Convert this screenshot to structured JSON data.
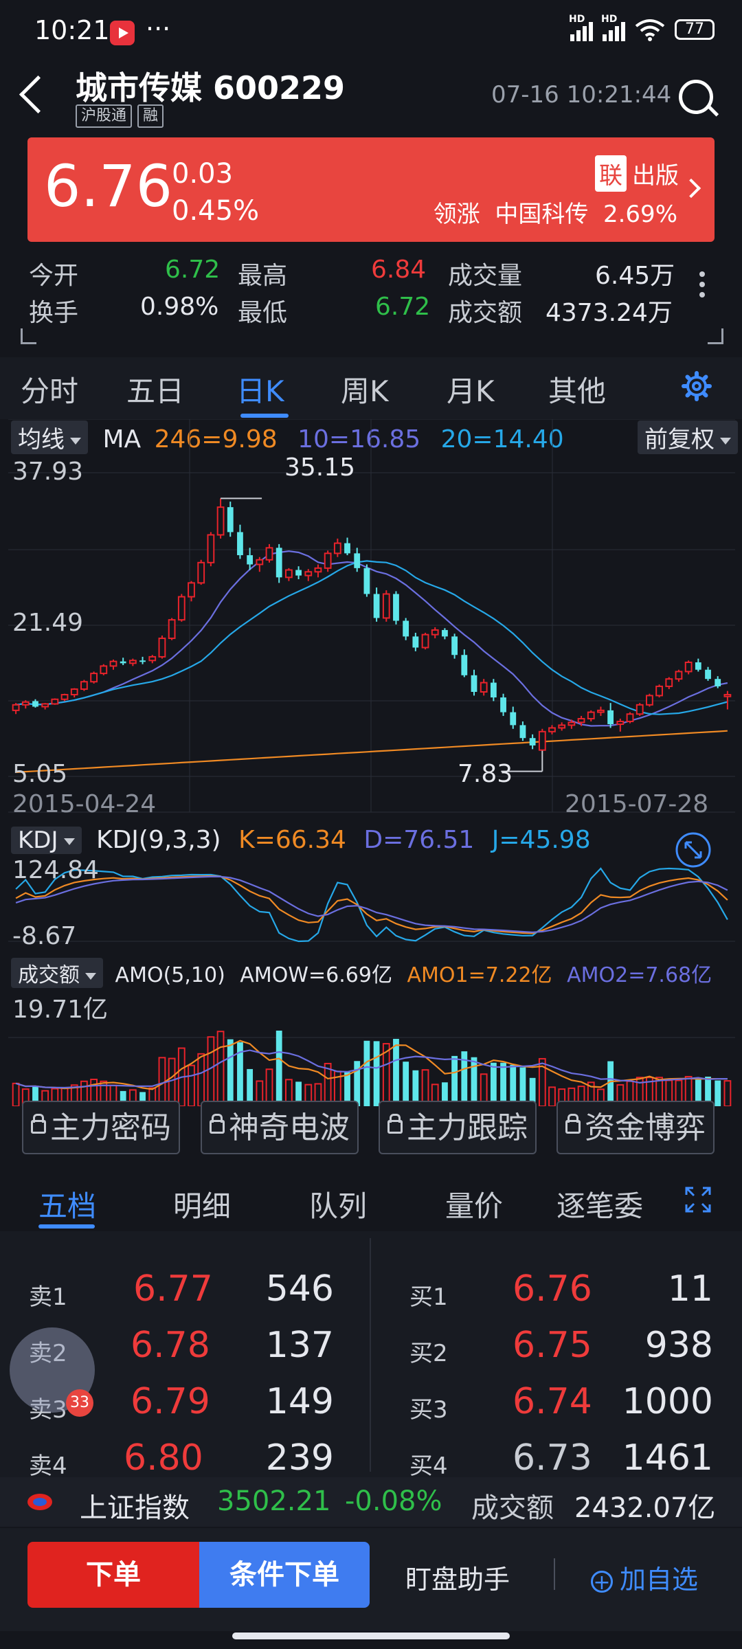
{
  "status": {
    "time": "10:21",
    "more": "···",
    "sim1": "HD",
    "sim2": "HD",
    "battery": "77"
  },
  "header": {
    "title": "城市传媒 600229",
    "tags": [
      "沪股通",
      "融"
    ],
    "datetime": "07-16 10:21:44"
  },
  "quote": {
    "price": "6.76",
    "change": "0.03",
    "change_pct": "0.45%",
    "badge": "联",
    "badge_text": "出版",
    "leader_label": "领涨",
    "leader_name": "中国科传",
    "leader_pct": "2.69%"
  },
  "stats": {
    "open_label": "今开",
    "open": "6.72",
    "high_label": "最高",
    "high": "6.84",
    "volume_label": "成交量",
    "volume": "6.45万",
    "turnover_label": "换手",
    "turnover": "0.98%",
    "low_label": "最低",
    "low": "6.72",
    "amount_label": "成交额",
    "amount": "4373.24万"
  },
  "tabs": [
    "分时",
    "五日",
    "日K",
    "周K",
    "月K",
    "其他"
  ],
  "active_tab": "日K",
  "chart": {
    "ma_dropdown": "均线",
    "ma_label": "MA",
    "ma246": "246=9.98",
    "ma10": "10=16.85",
    "ma20": "20=14.40",
    "adjust": "前复权",
    "y_top": "37.93",
    "y_mid": "21.49",
    "y_bot": "5.05",
    "max_label": "35.15",
    "min_label": "7.83",
    "date_start": "2015-04-24",
    "date_end": "2015-07-28",
    "kdj_dropdown": "KDJ",
    "kdj_params": "KDJ(9,3,3)",
    "kdj_k": "K=66.34",
    "kdj_d": "D=76.51",
    "kdj_j": "J=45.98",
    "kdj_top": "124.84",
    "kdj_bot": "-8.67",
    "amo_dropdown": "成交额",
    "amo_params": "AMO(5,10)",
    "amow": "AMOW=6.69亿",
    "amo1": "AMO1=7.22亿",
    "amo2": "AMO2=7.68亿",
    "amo_top": "19.71亿",
    "colors": {
      "up": "#e8232b",
      "down": "#5ee6ea",
      "ma246": "#f08a24",
      "ma10": "#6b6fe0",
      "ma20": "#26a8e8"
    }
  },
  "chart_data": [
    {
      "type": "candlestick",
      "title": "",
      "x_range": [
        "2015-04-24",
        "2015-07-28"
      ],
      "ylim": [
        5.05,
        37.93
      ],
      "y_ticks": [
        37.93,
        21.49,
        5.05
      ],
      "annotations": [
        {
          "label": "35.15",
          "type": "max"
        },
        {
          "label": "7.83",
          "type": "min"
        }
      ],
      "ohlc": [
        [
          12.2,
          13.0,
          11.8,
          12.8
        ],
        [
          12.8,
          13.3,
          12.4,
          13.1
        ],
        [
          13.2,
          13.4,
          12.5,
          12.6
        ],
        [
          12.6,
          13.0,
          12.3,
          12.9
        ],
        [
          12.9,
          13.5,
          12.8,
          13.4
        ],
        [
          13.4,
          14.0,
          13.2,
          13.9
        ],
        [
          13.9,
          14.6,
          13.6,
          14.5
        ],
        [
          14.5,
          15.5,
          14.3,
          15.3
        ],
        [
          15.3,
          16.4,
          15.1,
          16.2
        ],
        [
          16.2,
          17.2,
          16.0,
          17.0
        ],
        [
          17.0,
          17.7,
          16.6,
          17.5
        ],
        [
          17.5,
          17.9,
          17.1,
          17.3
        ],
        [
          17.3,
          17.8,
          17.0,
          17.6
        ],
        [
          17.6,
          18.0,
          17.2,
          17.5
        ],
        [
          17.6,
          18.2,
          17.3,
          18.0
        ],
        [
          18.0,
          20.3,
          17.8,
          20.0
        ],
        [
          20.0,
          22.2,
          19.8,
          22.0
        ],
        [
          22.0,
          24.8,
          21.8,
          24.5
        ],
        [
          24.5,
          26.2,
          24.0,
          26.0
        ],
        [
          26.0,
          28.5,
          25.8,
          28.2
        ],
        [
          28.2,
          31.5,
          27.8,
          31.2
        ],
        [
          31.2,
          35.15,
          30.8,
          34.2
        ],
        [
          34.2,
          34.8,
          31.0,
          31.5
        ],
        [
          31.5,
          32.3,
          28.6,
          29.0
        ],
        [
          29.0,
          29.8,
          27.4,
          28.0
        ],
        [
          28.0,
          28.8,
          27.2,
          28.5
        ],
        [
          28.5,
          30.2,
          28.2,
          29.8
        ],
        [
          29.8,
          30.2,
          26.0,
          26.6
        ],
        [
          26.6,
          27.6,
          26.2,
          27.4
        ],
        [
          27.4,
          27.8,
          26.4,
          26.8
        ],
        [
          26.8,
          27.5,
          26.2,
          27.2
        ],
        [
          27.2,
          28.0,
          26.6,
          27.6
        ],
        [
          27.6,
          29.5,
          27.2,
          29.2
        ],
        [
          29.2,
          30.8,
          28.8,
          30.3
        ],
        [
          30.3,
          30.9,
          29.0,
          29.2
        ],
        [
          29.2,
          29.8,
          27.2,
          27.6
        ],
        [
          27.6,
          28.0,
          24.5,
          24.8
        ],
        [
          24.8,
          25.5,
          21.8,
          22.2
        ],
        [
          22.2,
          25.2,
          21.8,
          24.8
        ],
        [
          24.8,
          25.1,
          21.5,
          21.9
        ],
        [
          21.9,
          22.2,
          19.8,
          20.2
        ],
        [
          20.2,
          20.6,
          18.6,
          19.0
        ],
        [
          19.0,
          20.6,
          18.8,
          20.4
        ],
        [
          20.4,
          21.2,
          20.0,
          20.9
        ],
        [
          20.9,
          21.1,
          19.9,
          20.2
        ],
        [
          20.2,
          20.5,
          17.8,
          18.2
        ],
        [
          18.2,
          18.8,
          15.8,
          16.0
        ],
        [
          16.0,
          16.6,
          13.8,
          14.2
        ],
        [
          14.2,
          15.6,
          13.8,
          15.2
        ],
        [
          15.2,
          15.6,
          13.2,
          13.6
        ],
        [
          13.6,
          14.0,
          11.6,
          12.0
        ],
        [
          12.0,
          12.6,
          10.2,
          10.6
        ],
        [
          10.6,
          11.0,
          8.9,
          9.2
        ],
        [
          9.2,
          9.6,
          8.0,
          8.4
        ],
        [
          7.9,
          10.2,
          7.83,
          9.9
        ],
        [
          9.9,
          10.6,
          9.6,
          10.3
        ],
        [
          10.3,
          10.9,
          10.0,
          10.6
        ],
        [
          10.6,
          11.2,
          10.2,
          10.9
        ],
        [
          10.9,
          11.6,
          10.5,
          11.3
        ],
        [
          11.3,
          12.2,
          11.0,
          12.0
        ],
        [
          12.0,
          12.6,
          11.6,
          12.2
        ],
        [
          12.2,
          13.0,
          10.3,
          10.7
        ],
        [
          10.7,
          11.3,
          9.9,
          11.0
        ],
        [
          11.0,
          12.0,
          10.8,
          11.8
        ],
        [
          11.8,
          13.0,
          11.6,
          12.8
        ],
        [
          12.8,
          14.0,
          12.6,
          13.8
        ],
        [
          13.8,
          15.0,
          13.6,
          14.8
        ],
        [
          14.8,
          15.8,
          14.5,
          15.6
        ],
        [
          15.6,
          16.6,
          15.3,
          16.4
        ],
        [
          16.4,
          17.6,
          16.1,
          17.4
        ],
        [
          17.4,
          17.8,
          16.4,
          16.6
        ],
        [
          16.6,
          16.9,
          15.4,
          15.6
        ],
        [
          15.6,
          15.9,
          14.6,
          14.8
        ],
        [
          13.7,
          14.3,
          12.3,
          13.9
        ]
      ],
      "series": [
        {
          "name": "MA246",
          "last": 9.98
        },
        {
          "name": "MA10",
          "last": 16.85
        },
        {
          "name": "MA20",
          "last": 14.4
        }
      ]
    },
    {
      "type": "line",
      "title": "KDJ(9,3,3)",
      "ylim": [
        -8.67,
        124.84
      ],
      "series": [
        {
          "name": "K",
          "last": 66.34
        },
        {
          "name": "D",
          "last": 76.51
        },
        {
          "name": "J",
          "last": 45.98
        }
      ]
    },
    {
      "type": "bar",
      "title": "AMO(5,10)",
      "y_max_label": "19.71亿",
      "series": [
        {
          "name": "AMO1",
          "last": "7.22亿"
        },
        {
          "name": "AMO2",
          "last": "7.68亿"
        }
      ]
    }
  ],
  "features": [
    "主力密码",
    "神奇电波",
    "主力跟踪",
    "资金博弈"
  ],
  "orderbook": {
    "tabs": [
      "五档",
      "明细",
      "队列",
      "量价",
      "逐笔委"
    ],
    "sell": [
      {
        "label": "卖1",
        "price": "6.77",
        "vol": "546"
      },
      {
        "label": "卖2",
        "price": "6.78",
        "vol": "137"
      },
      {
        "label": "卖3",
        "price": "6.79",
        "vol": "149"
      },
      {
        "label": "卖4",
        "price": "6.80",
        "vol": "239"
      }
    ],
    "buy": [
      {
        "label": "买1",
        "price": "6.76",
        "vol": "11"
      },
      {
        "label": "买2",
        "price": "6.75",
        "vol": "938"
      },
      {
        "label": "买3",
        "price": "6.74",
        "vol": "1000"
      },
      {
        "label": "买4",
        "price": "6.73",
        "vol": "1461"
      }
    ]
  },
  "index": {
    "name": "上证指数",
    "value": "3502.21",
    "pct": "-0.08%",
    "amount_label": "成交额",
    "amount": "2432.07亿"
  },
  "bottom": {
    "order": "下单",
    "cond_order": "条件下单",
    "assistant": "盯盘助手",
    "add_watch": "加自选"
  }
}
